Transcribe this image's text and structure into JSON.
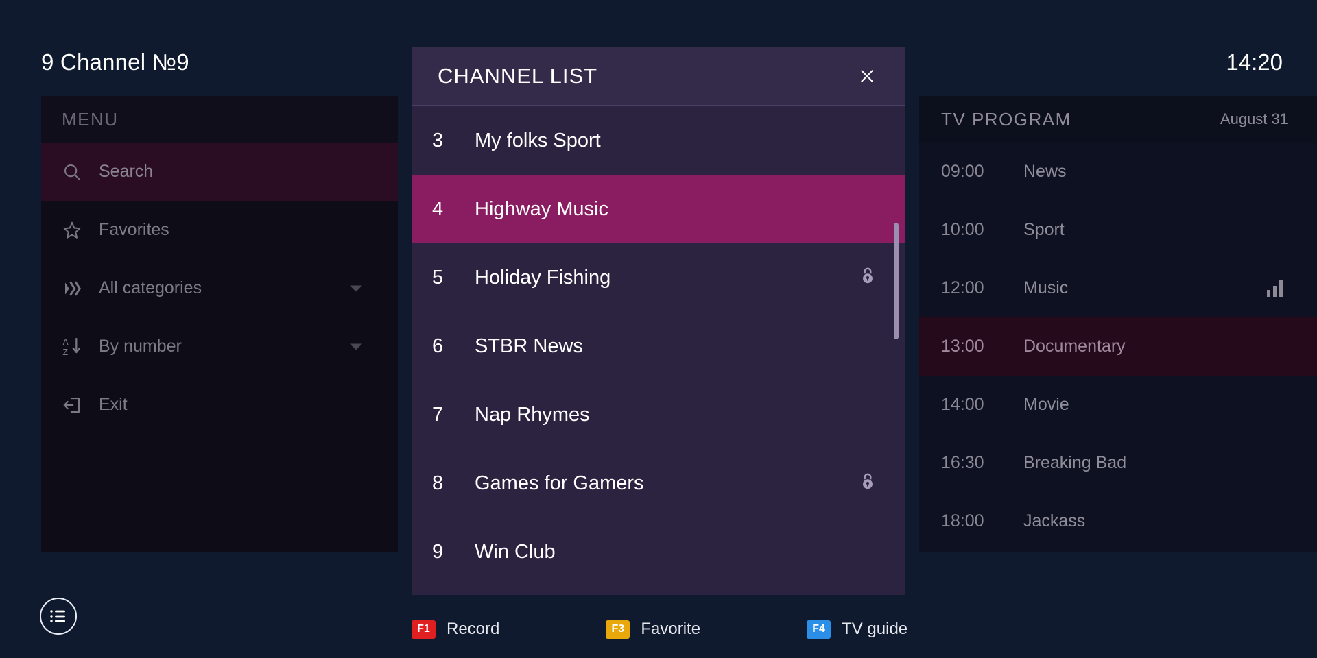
{
  "topbar": {
    "now_channel": "9 Channel №9",
    "clock": "14:20"
  },
  "menu": {
    "header": "MENU",
    "items": [
      {
        "label": "Search",
        "icon": "search-icon",
        "active": true,
        "chevron": false
      },
      {
        "label": "Favorites",
        "icon": "star-icon",
        "active": false,
        "chevron": false
      },
      {
        "label": "All categories",
        "icon": "categories-icon",
        "active": false,
        "chevron": true
      },
      {
        "label": "By number",
        "icon": "sort-az-icon",
        "active": false,
        "chevron": true
      },
      {
        "label": "Exit",
        "icon": "exit-icon",
        "active": false,
        "chevron": false
      }
    ]
  },
  "channel_list": {
    "title": "CHANNEL LIST",
    "close_label": "×",
    "channels": [
      {
        "number": "3",
        "name": "My folks Sport",
        "locked": false,
        "selected": false
      },
      {
        "number": "4",
        "name": "Highway Music",
        "locked": false,
        "selected": true
      },
      {
        "number": "5",
        "name": "Holiday Fishing",
        "locked": true,
        "selected": false
      },
      {
        "number": "6",
        "name": "STBR News",
        "locked": false,
        "selected": false
      },
      {
        "number": "7",
        "name": "Nap Rhymes",
        "locked": false,
        "selected": false
      },
      {
        "number": "8",
        "name": "Games for Gamers",
        "locked": true,
        "selected": false
      },
      {
        "number": "9",
        "name": "Win Club",
        "locked": false,
        "selected": false
      }
    ]
  },
  "tv_program": {
    "title": "TV PROGRAM",
    "date": "August 31",
    "rows": [
      {
        "time": "09:00",
        "name": "News",
        "highlight": false,
        "playing": false
      },
      {
        "time": "10:00",
        "name": "Sport",
        "highlight": false,
        "playing": false
      },
      {
        "time": "12:00",
        "name": "Music",
        "highlight": false,
        "playing": true
      },
      {
        "time": "13:00",
        "name": "Documentary",
        "highlight": true,
        "playing": false
      },
      {
        "time": "14:00",
        "name": "Movie",
        "highlight": false,
        "playing": false
      },
      {
        "time": "16:30",
        "name": "Breaking Bad",
        "highlight": false,
        "playing": false
      },
      {
        "time": "18:00",
        "name": "Jackass",
        "highlight": false,
        "playing": false
      }
    ]
  },
  "bottombar": {
    "fkeys": [
      {
        "key": "F1",
        "label": "Record",
        "color": "#e02020"
      },
      {
        "key": "F3",
        "label": "Favorite",
        "color": "#e8a80c"
      },
      {
        "key": "F4",
        "label": "TV guide",
        "color": "#2b8fe8"
      }
    ]
  },
  "colors": {
    "background": "#101a2e",
    "modal_bg": "#2b2340",
    "modal_header": "#342a4a",
    "selected_channel": "#8a1d62",
    "menu_active": "#2a0c23",
    "tv_highlight": "#250a1c"
  }
}
